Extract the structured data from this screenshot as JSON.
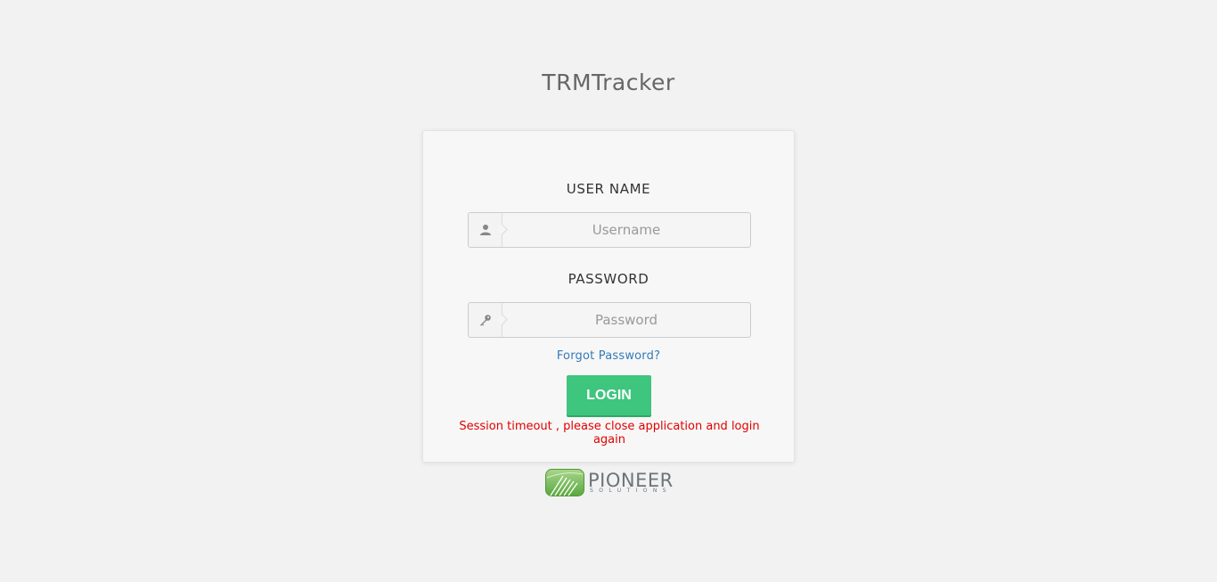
{
  "app": {
    "title": "TRMTracker"
  },
  "login": {
    "username_label": "USER NAME",
    "username_placeholder": "Username",
    "username_value": "",
    "password_label": "PASSWORD",
    "password_placeholder": "Password",
    "password_value": "",
    "forgot_link": "Forgot Password?",
    "login_button": "LOGIN",
    "error_message": "Session timeout , please close application and login again"
  },
  "brand": {
    "name": "PIONEER",
    "subtitle": "SOLUTIONS",
    "logo_icon": "pioneer-logo-icon"
  },
  "icons": {
    "username": "user-icon",
    "password": "key-icon"
  },
  "colors": {
    "background": "#f2f2f2",
    "card": "#f7f7f7",
    "accent_green": "#3ec57e",
    "link_blue": "#337ab7",
    "error_red": "#e00000"
  }
}
